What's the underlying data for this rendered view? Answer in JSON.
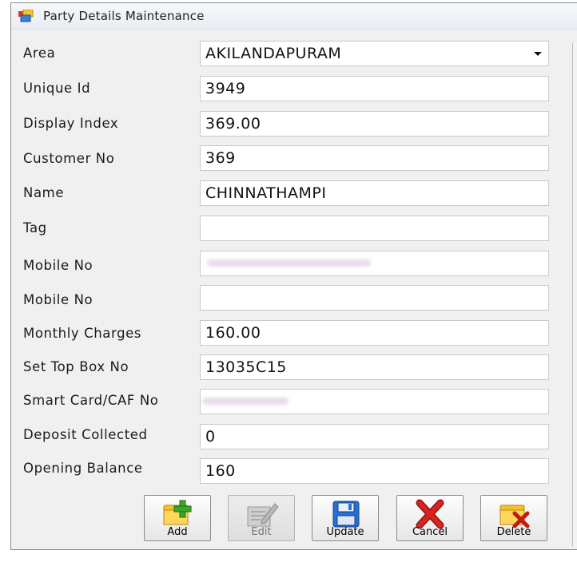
{
  "window": {
    "title": "Party Details  Maintenance"
  },
  "form": {
    "area": {
      "label": "Area",
      "value": "AKILANDAPURAM"
    },
    "unique_id": {
      "label": "Unique Id",
      "value": "3949"
    },
    "display_index": {
      "label": "Display Index",
      "value": "369.00"
    },
    "customer_no": {
      "label": "Customer No",
      "value": "369"
    },
    "name": {
      "label": "Name",
      "value": "CHINNATHAMPI"
    },
    "tag": {
      "label": "Tag",
      "value": ""
    },
    "mobile_no_1": {
      "label": "Mobile No",
      "value": ""
    },
    "mobile_no_2": {
      "label": "Mobile No",
      "value": ""
    },
    "monthly_charges": {
      "label": "Monthly Charges",
      "value": "160.00"
    },
    "set_top_box_no": {
      "label": "Set Top Box No",
      "value": "13035C15"
    },
    "smart_card_caf_no": {
      "label": "Smart Card/CAF No",
      "value": ""
    },
    "deposit_collected": {
      "label": "Deposit Collected",
      "value": "0"
    },
    "opening_balance": {
      "label": "Opening Balance",
      "value": "160"
    }
  },
  "toolbar": {
    "add_label": "Add",
    "edit_label": "Edit",
    "update_label": "Update",
    "cancel_label": "Cancel",
    "delete_label": "Delete"
  },
  "icons": {
    "title": "form-window-icon",
    "add": "add-plus-icon",
    "edit": "edit-pencil-icon",
    "update": "floppy-disk-icon",
    "cancel": "red-x-icon",
    "delete": "delete-icon"
  },
  "colors": {
    "window_bg": "#f0f0f0",
    "field_bg": "#ffffff",
    "cancel_red": "#d8241e",
    "add_green": "#3aa62a",
    "update_blue": "#2b6fd6"
  }
}
